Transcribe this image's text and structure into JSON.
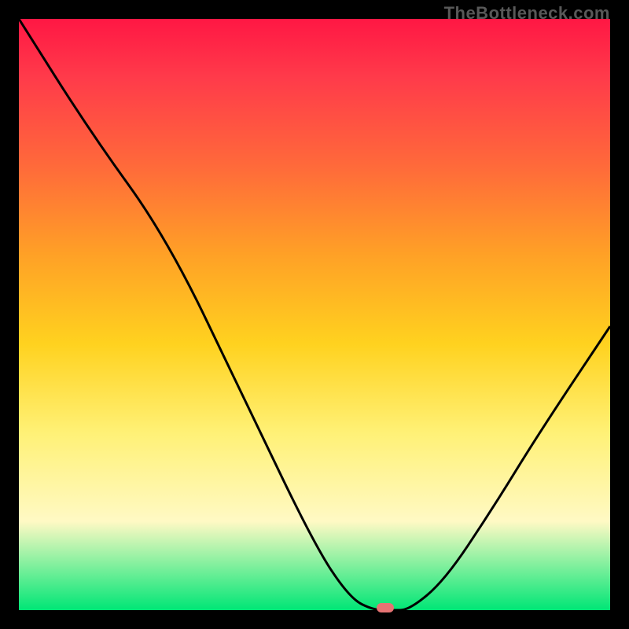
{
  "watermark": "TheBottleneck.com",
  "chart_data": {
    "type": "line",
    "title": "",
    "xlabel": "",
    "ylabel": "",
    "xlim": [
      0,
      100
    ],
    "ylim": [
      0,
      100
    ],
    "x": [
      0,
      12,
      25,
      38,
      50,
      56,
      60,
      63,
      66,
      72,
      80,
      88,
      100
    ],
    "values": [
      100,
      81,
      63,
      36,
      11,
      2,
      0,
      0,
      0,
      5,
      17,
      30,
      48
    ],
    "grid": false,
    "marker": {
      "x_percent": 62,
      "y_percent": 0
    },
    "gradient_stops": [
      {
        "pos": 0,
        "color": "#ff1744"
      },
      {
        "pos": 10,
        "color": "#ff3b4a"
      },
      {
        "pos": 25,
        "color": "#ff6a3a"
      },
      {
        "pos": 40,
        "color": "#ffa126"
      },
      {
        "pos": 55,
        "color": "#ffd21f"
      },
      {
        "pos": 70,
        "color": "#fff176"
      },
      {
        "pos": 85,
        "color": "#fff9c4"
      },
      {
        "pos": 100,
        "color": "#00e676"
      }
    ]
  }
}
